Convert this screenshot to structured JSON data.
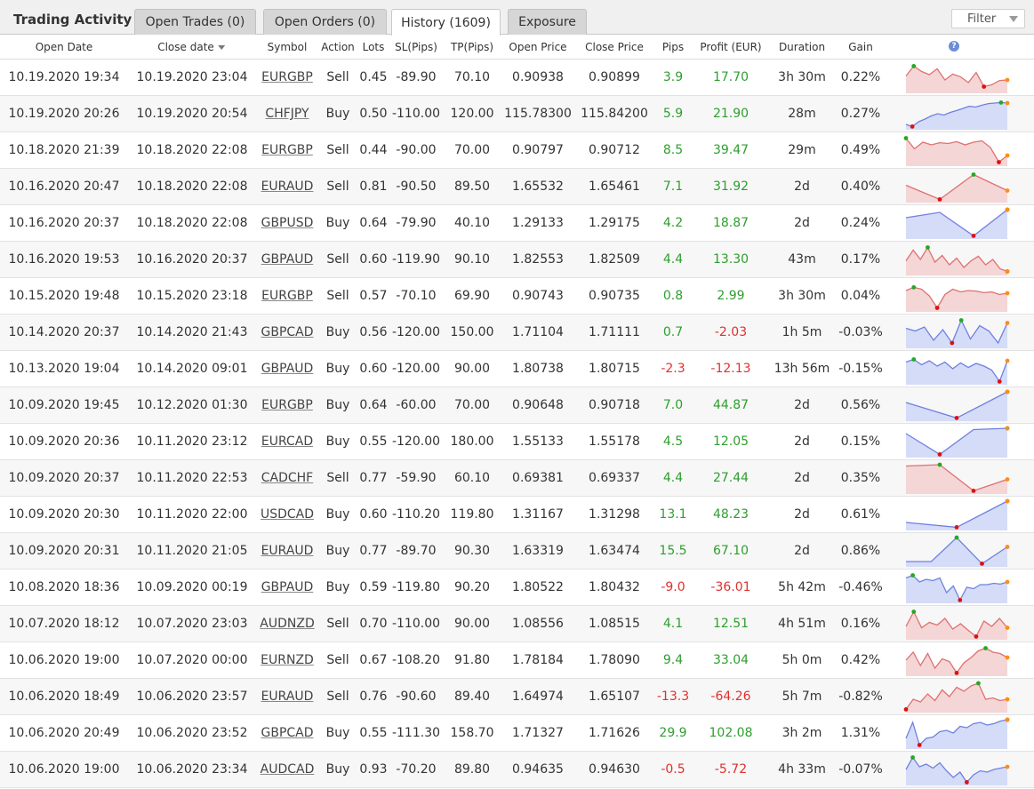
{
  "header": {
    "title": "Trading Activity",
    "tabs": [
      {
        "label": "Open Trades (0)",
        "active": false
      },
      {
        "label": "Open Orders (0)",
        "active": false
      },
      {
        "label": "History (1609)",
        "active": true
      },
      {
        "label": "Exposure",
        "active": false
      }
    ],
    "filter_label": "Filter"
  },
  "columns": [
    "Open Date",
    "Close date",
    "Symbol",
    "Action",
    "Lots",
    "SL(Pips)",
    "TP(Pips)",
    "Open Price",
    "Close Price",
    "Pips",
    "Profit (EUR)",
    "Duration",
    "Gain"
  ],
  "help_icon_glyph": "?",
  "colors": {
    "positive": "#2e9e2e",
    "negative": "#e03030",
    "sell_line": "#e07070",
    "sell_fill": "#f4d6d6",
    "buy_line": "#7080e0",
    "buy_fill": "#d4dcf8",
    "high_dot": "#22aa22",
    "low_dot": "#dd1111",
    "last_dot": "#ff8c1a"
  },
  "rows": [
    {
      "open_date": "10.19.2020 19:34",
      "close_date": "10.19.2020 23:04",
      "symbol": "EURGBP",
      "action": "Sell",
      "lots": "0.45",
      "sl": "-89.90",
      "tp": "70.10",
      "open_price": "0.90938",
      "close_price": "0.90899",
      "pips": "3.9",
      "profit": "17.70",
      "duration": "3h 30m",
      "gain": "0.22%",
      "spark": [
        0.55,
        0.92,
        0.72,
        0.6,
        0.82,
        0.4,
        0.62,
        0.52,
        0.3,
        0.68,
        0.15,
        0.22,
        0.38,
        0.4
      ]
    },
    {
      "open_date": "10.19.2020 20:26",
      "close_date": "10.19.2020 20:54",
      "symbol": "CHFJPY",
      "action": "Buy",
      "lots": "0.50",
      "sl": "-110.00",
      "tp": "120.00",
      "open_price": "115.78300",
      "close_price": "115.84200",
      "pips": "5.9",
      "profit": "21.90",
      "duration": "28m",
      "gain": "0.27%",
      "spark": [
        0.1,
        0.02,
        0.2,
        0.3,
        0.42,
        0.5,
        0.45,
        0.55,
        0.62,
        0.7,
        0.78,
        0.75,
        0.82,
        0.88,
        0.9,
        0.92,
        0.9
      ]
    },
    {
      "open_date": "10.18.2020 21:39",
      "close_date": "10.18.2020 22:08",
      "symbol": "EURGBP",
      "action": "Sell",
      "lots": "0.44",
      "sl": "-90.00",
      "tp": "70.00",
      "open_price": "0.90797",
      "close_price": "0.90712",
      "pips": "8.5",
      "profit": "39.47",
      "duration": "29m",
      "gain": "0.49%",
      "spark": [
        0.95,
        0.55,
        0.8,
        0.7,
        0.78,
        0.75,
        0.82,
        0.7,
        0.8,
        0.85,
        0.6,
        0.05,
        0.3
      ]
    },
    {
      "open_date": "10.16.2020 20:47",
      "close_date": "10.18.2020 22:08",
      "symbol": "EURAUD",
      "action": "Sell",
      "lots": "0.81",
      "sl": "-90.50",
      "tp": "89.50",
      "open_price": "1.65532",
      "close_price": "1.65461",
      "pips": "7.1",
      "profit": "31.92",
      "duration": "2d",
      "gain": "0.40%",
      "spark": [
        0.55,
        0.02,
        0.95,
        0.35
      ]
    },
    {
      "open_date": "10.16.2020 20:37",
      "close_date": "10.18.2020 22:08",
      "symbol": "GBPUSD",
      "action": "Buy",
      "lots": "0.64",
      "sl": "-79.90",
      "tp": "40.10",
      "open_price": "1.29133",
      "close_price": "1.29175",
      "pips": "4.2",
      "profit": "18.87",
      "duration": "2d",
      "gain": "0.24%",
      "spark": [
        0.7,
        0.9,
        0.02,
        1.0
      ]
    },
    {
      "open_date": "10.16.2020 19:53",
      "close_date": "10.16.2020 20:37",
      "symbol": "GBPAUD",
      "action": "Sell",
      "lots": "0.60",
      "sl": "-119.90",
      "tp": "90.10",
      "open_price": "1.82553",
      "close_price": "1.82509",
      "pips": "4.4",
      "profit": "13.30",
      "duration": "43m",
      "gain": "0.17%",
      "spark": [
        0.45,
        0.85,
        0.5,
        0.95,
        0.4,
        0.65,
        0.3,
        0.55,
        0.2,
        0.45,
        0.62,
        0.3,
        0.5,
        0.15,
        0.05
      ]
    },
    {
      "open_date": "10.15.2020 19:48",
      "close_date": "10.15.2020 23:18",
      "symbol": "EURGBP",
      "action": "Sell",
      "lots": "0.57",
      "sl": "-70.10",
      "tp": "69.90",
      "open_price": "0.90743",
      "close_price": "0.90735",
      "pips": "0.8",
      "profit": "2.99",
      "duration": "3h 30m",
      "gain": "0.04%",
      "spark": [
        0.7,
        0.82,
        0.75,
        0.5,
        0.05,
        0.55,
        0.75,
        0.65,
        0.7,
        0.68,
        0.62,
        0.65,
        0.55,
        0.6
      ]
    },
    {
      "open_date": "10.14.2020 20:37",
      "close_date": "10.14.2020 21:43",
      "symbol": "GBPCAD",
      "action": "Buy",
      "lots": "0.56",
      "sl": "-120.00",
      "tp": "150.00",
      "open_price": "1.71104",
      "close_price": "1.71111",
      "pips": "0.7",
      "profit": "-2.03",
      "duration": "1h 5m",
      "gain": "-0.03%",
      "spark": [
        0.65,
        0.55,
        0.7,
        0.2,
        0.6,
        0.1,
        0.95,
        0.25,
        0.75,
        0.55,
        0.1,
        0.85
      ]
    },
    {
      "open_date": "10.13.2020 19:04",
      "close_date": "10.14.2020 09:01",
      "symbol": "GBPAUD",
      "action": "Buy",
      "lots": "0.60",
      "sl": "-120.00",
      "tp": "90.00",
      "open_price": "1.80738",
      "close_price": "1.80715",
      "pips": "-2.3",
      "profit": "-12.13",
      "duration": "13h 56m",
      "gain": "-0.15%",
      "spark": [
        0.75,
        0.85,
        0.65,
        0.8,
        0.6,
        0.75,
        0.5,
        0.72,
        0.55,
        0.7,
        0.6,
        0.45,
        0.02,
        0.8
      ]
    },
    {
      "open_date": "10.09.2020 19:45",
      "close_date": "10.12.2020 01:30",
      "symbol": "EURGBP",
      "action": "Buy",
      "lots": "0.64",
      "sl": "-60.00",
      "tp": "70.00",
      "open_price": "0.90648",
      "close_price": "0.90718",
      "pips": "7.0",
      "profit": "44.87",
      "duration": "2d",
      "gain": "0.56%",
      "spark": [
        0.6,
        0.02,
        1.0
      ]
    },
    {
      "open_date": "10.09.2020 20:36",
      "close_date": "10.11.2020 23:12",
      "symbol": "EURCAD",
      "action": "Buy",
      "lots": "0.55",
      "sl": "-120.00",
      "tp": "180.00",
      "open_price": "1.55133",
      "close_price": "1.55178",
      "pips": "4.5",
      "profit": "12.05",
      "duration": "2d",
      "gain": "0.15%",
      "spark": [
        0.8,
        0.02,
        0.95,
        1.0
      ]
    },
    {
      "open_date": "10.09.2020 20:37",
      "close_date": "10.11.2020 22:53",
      "symbol": "CADCHF",
      "action": "Sell",
      "lots": "0.77",
      "sl": "-59.90",
      "tp": "60.10",
      "open_price": "0.69381",
      "close_price": "0.69337",
      "pips": "4.4",
      "profit": "27.44",
      "duration": "2d",
      "gain": "0.35%",
      "spark": [
        0.95,
        1.0,
        0.02,
        0.45
      ]
    },
    {
      "open_date": "10.09.2020 20:30",
      "close_date": "10.11.2020 22:00",
      "symbol": "USDCAD",
      "action": "Buy",
      "lots": "0.60",
      "sl": "-110.20",
      "tp": "119.80",
      "open_price": "1.31167",
      "close_price": "1.31298",
      "pips": "13.1",
      "profit": "48.23",
      "duration": "2d",
      "gain": "0.61%",
      "spark": [
        0.2,
        0.02,
        1.0
      ]
    },
    {
      "open_date": "10.09.2020 20:31",
      "close_date": "10.11.2020 21:05",
      "symbol": "EURAUD",
      "action": "Buy",
      "lots": "0.77",
      "sl": "-89.70",
      "tp": "90.30",
      "open_price": "1.63319",
      "close_price": "1.63474",
      "pips": "15.5",
      "profit": "67.10",
      "duration": "2d",
      "gain": "0.86%",
      "spark": [
        0.1,
        0.1,
        1.0,
        0.02,
        0.65
      ]
    },
    {
      "open_date": "10.08.2020 18:36",
      "close_date": "10.09.2020 00:19",
      "symbol": "GBPAUD",
      "action": "Buy",
      "lots": "0.59",
      "sl": "-119.80",
      "tp": "90.20",
      "open_price": "1.80522",
      "close_price": "1.80432",
      "pips": "-9.0",
      "profit": "-36.01",
      "duration": "5h 42m",
      "gain": "-0.46%",
      "spark": [
        0.85,
        0.95,
        0.7,
        0.8,
        0.75,
        0.85,
        0.3,
        0.55,
        0.02,
        0.5,
        0.45,
        0.6,
        0.6,
        0.65,
        0.62,
        0.7
      ]
    },
    {
      "open_date": "10.07.2020 18:12",
      "close_date": "10.07.2020 23:03",
      "symbol": "AUDNZD",
      "action": "Sell",
      "lots": "0.70",
      "sl": "-110.00",
      "tp": "90.00",
      "open_price": "1.08556",
      "close_price": "1.08515",
      "pips": "4.1",
      "profit": "12.51",
      "duration": "4h 51m",
      "gain": "0.16%",
      "spark": [
        0.4,
        0.95,
        0.35,
        0.55,
        0.45,
        0.7,
        0.3,
        0.5,
        0.25,
        0.02,
        0.6,
        0.4,
        0.7,
        0.35
      ]
    },
    {
      "open_date": "10.06.2020 19:00",
      "close_date": "10.07.2020 00:00",
      "symbol": "EURNZD",
      "action": "Sell",
      "lots": "0.67",
      "sl": "-108.20",
      "tp": "91.80",
      "open_price": "1.78184",
      "close_price": "1.78090",
      "pips": "9.4",
      "profit": "33.04",
      "duration": "5h 0m",
      "gain": "0.42%",
      "spark": [
        0.5,
        0.8,
        0.3,
        0.75,
        0.2,
        0.55,
        0.45,
        0.02,
        0.4,
        0.6,
        0.85,
        0.95,
        0.8,
        0.75,
        0.6
      ]
    },
    {
      "open_date": "10.06.2020 18:49",
      "close_date": "10.06.2020 23:57",
      "symbol": "EURAUD",
      "action": "Sell",
      "lots": "0.76",
      "sl": "-90.60",
      "tp": "89.40",
      "open_price": "1.64974",
      "close_price": "1.65107",
      "pips": "-13.3",
      "profit": "-64.26",
      "duration": "5h 7m",
      "gain": "-0.82%",
      "spark": [
        0.02,
        0.4,
        0.3,
        0.6,
        0.35,
        0.75,
        0.5,
        0.85,
        0.7,
        0.9,
        1.0,
        0.4,
        0.45,
        0.35,
        0.4
      ]
    },
    {
      "open_date": "10.06.2020 20:49",
      "close_date": "10.06.2020 23:52",
      "symbol": "GBPCAD",
      "action": "Buy",
      "lots": "0.55",
      "sl": "-111.30",
      "tp": "158.70",
      "open_price": "1.71327",
      "close_price": "1.71626",
      "pips": "29.9",
      "profit": "102.08",
      "duration": "3h 2m",
      "gain": "1.31%",
      "spark": [
        0.3,
        0.9,
        0.05,
        0.3,
        0.35,
        0.55,
        0.6,
        0.5,
        0.75,
        0.7,
        0.85,
        0.9,
        0.8,
        0.85,
        0.95,
        1.0
      ]
    },
    {
      "open_date": "10.06.2020 19:00",
      "close_date": "10.06.2020 23:34",
      "symbol": "AUDCAD",
      "action": "Buy",
      "lots": "0.93",
      "sl": "-70.20",
      "tp": "89.80",
      "open_price": "0.94635",
      "close_price": "0.94630",
      "pips": "-0.5",
      "profit": "-5.72",
      "duration": "4h 33m",
      "gain": "-0.07%",
      "spark": [
        0.5,
        0.95,
        0.6,
        0.7,
        0.55,
        0.75,
        0.45,
        0.2,
        0.4,
        0.02,
        0.3,
        0.45,
        0.4,
        0.5,
        0.55,
        0.6
      ]
    }
  ]
}
